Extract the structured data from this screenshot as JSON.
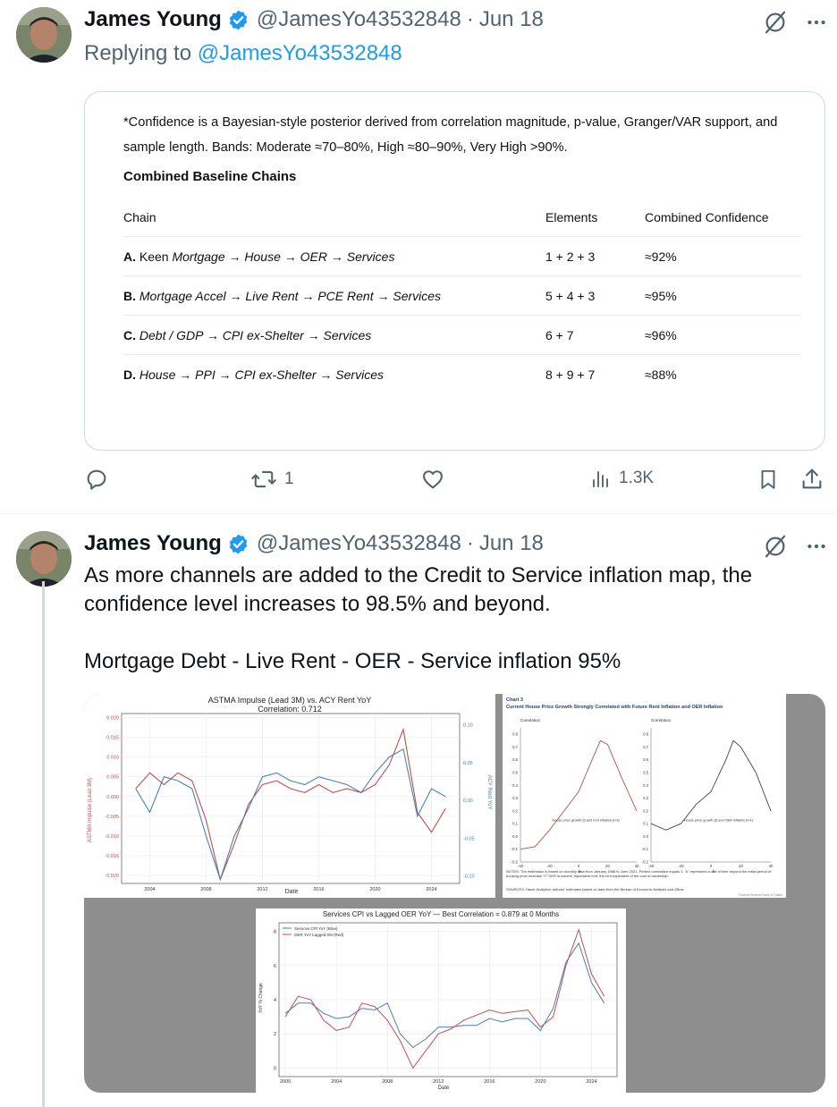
{
  "tweet1": {
    "name": "James Young",
    "handle": "@JamesYo43532848",
    "separator": "·",
    "date": "Jun 18",
    "reply_prefix": "Replying to",
    "reply_handle": "@JamesYo43532848",
    "card": {
      "note": "*Confidence is a Bayesian-style posterior derived from correlation magnitude, p-value, Granger/VAR support, and sample length. Bands: Moderate ≈70–80%, High ≈80–90%, Very High >90%.",
      "title": "Combined Baseline Chains",
      "headers": [
        "Chain",
        "Elements",
        "Combined Confidence"
      ],
      "rows": [
        {
          "letter": "A.",
          "prefix": "Keen",
          "chain": "Mortgage → House → OER → Services",
          "elements": "1 + 2 + 3",
          "confidence": "≈92%"
        },
        {
          "letter": "B.",
          "prefix": "",
          "chain": "Mortgage Accel → Live Rent → PCE Rent → Services",
          "elements": "5 + 4 + 3",
          "confidence": "≈95%"
        },
        {
          "letter": "C.",
          "prefix": "",
          "chain": "Debt / GDP → CPI ex-Shelter → Services",
          "elements": "6 + 7",
          "confidence": "≈96%"
        },
        {
          "letter": "D.",
          "prefix": "",
          "chain": "House → PPI → CPI ex-Shelter → Services",
          "elements": "8 + 9 + 7",
          "confidence": "≈88%"
        }
      ]
    },
    "actions": {
      "replies": "",
      "reposts": "1",
      "likes": "",
      "views": "1.3K"
    }
  },
  "tweet2": {
    "name": "James Young",
    "handle": "@JamesYo43532848",
    "separator": "·",
    "date": "Jun 18",
    "text_para1": "As more channels are added to the Credit to Service inflation map, the confidence level increases to 98.5% and beyond.",
    "text_para2": "Mortgage Debt - Live Rent - OER - Service inflation 95%"
  },
  "colors": {
    "link": "#1d9bf0",
    "verified": "#1d9bf0",
    "muted": "#536471",
    "red_series": "#c0504d",
    "blue_series": "#4a7fb5"
  },
  "chart_data": [
    {
      "type": "line",
      "title": "ASTMA Impulse (Lead 3M) vs. ACY Rent YoY",
      "subtitle": "Correlation: 0.712",
      "xlabel": "Date",
      "ylabel_left": "ASTMA Impulse (Lead 3M)",
      "ylabel_right": "ACY Rent YoY",
      "x_ticks": [
        "2004",
        "2008",
        "2012",
        "2016",
        "2020",
        "2024"
      ],
      "y_left_ticks": [
        "0.020",
        "0.015",
        "0.010",
        "0.005",
        "0.000",
        "-0.005",
        "-0.010",
        "-0.015",
        "-0.020"
      ],
      "y_right_ticks": [
        "0.10",
        "0.05",
        "0.00",
        "-0.05",
        "-0.10"
      ],
      "ylim_left": [
        -0.022,
        0.021
      ],
      "series": [
        {
          "color": "red",
          "x": [
            2003,
            2004,
            2005,
            2006,
            2007,
            2008,
            2009,
            2010,
            2011,
            2012,
            2013,
            2014,
            2015,
            2016,
            2017,
            2018,
            2019,
            2020,
            2021,
            2022,
            2023,
            2024,
            2025
          ],
          "values": [
            0.002,
            0.006,
            0.003,
            0.006,
            0.004,
            -0.006,
            -0.021,
            -0.012,
            -0.002,
            0.003,
            0.004,
            0.002,
            0.001,
            0.003,
            0.001,
            0.002,
            0.001,
            0.003,
            0.008,
            0.017,
            -0.004,
            -0.009,
            -0.003
          ]
        },
        {
          "color": "blue",
          "x": [
            2003,
            2004,
            2005,
            2006,
            2007,
            2008,
            2009,
            2010,
            2011,
            2012,
            2013,
            2014,
            2015,
            2016,
            2017,
            2018,
            2019,
            2020,
            2021,
            2022,
            2023,
            2024,
            2025
          ],
          "values": [
            0.002,
            -0.004,
            0.005,
            0.004,
            0.002,
            -0.01,
            -0.021,
            -0.01,
            -0.003,
            0.005,
            0.006,
            0.004,
            0.003,
            0.005,
            0.004,
            0.003,
            0.001,
            0.006,
            0.01,
            0.012,
            -0.005,
            0.002,
            0.0
          ]
        }
      ]
    },
    {
      "type": "line",
      "chart_label": "Chart 3",
      "title": "Current House Price Growth Strongly Correlated with Future Rent Inflation and OER Inflation",
      "panels": [
        {
          "ylabel": "Correlation",
          "legend": "House price growth (t) and rent inflation (t+k)",
          "x": [
            -40,
            -30,
            -20,
            -10,
            0,
            10,
            15,
            20,
            30,
            40
          ],
          "values": [
            -0.1,
            -0.08,
            0.05,
            0.2,
            0.35,
            0.62,
            0.75,
            0.72,
            0.45,
            0.2
          ]
        },
        {
          "ylabel": "Correlation",
          "legend": "House price growth (t) and OER inflation (t+k)",
          "x": [
            -40,
            -30,
            -20,
            -10,
            0,
            10,
            15,
            20,
            30,
            40
          ],
          "values": [
            0.1,
            0.05,
            0.1,
            0.25,
            0.35,
            0.6,
            0.75,
            0.7,
            0.5,
            0.2
          ]
        }
      ],
      "x_ticks": [
        "-40",
        "-20",
        "0",
        "20",
        "40"
      ],
      "y_ticks": [
        "0.8",
        "0.7",
        "0.6",
        "0.5",
        "0.4",
        "0.3",
        "0.2",
        "0.1",
        "0.0",
        "-0.1",
        "-0.2"
      ],
      "xlabel": "k",
      "notes": "NOTES: The estimation is based on monthly data from January 1986 to June 2021. Perfect correlation equals 1. \"k\" represents a unit of time beyond the initial period of housing price increase \"t.\" OER is owners' equivalent rent, the rent equivalent of the cost of ownership.",
      "sources": "SOURCES: Haver Analytics; authors' estimates based on data from the Bureau of Economic Analysis and Zillow.",
      "credit": "Federal Reserve Bank of Dallas"
    },
    {
      "type": "line",
      "title": "Services CPI vs Lagged OER YoY — Best Correlation = 0.879 at 0 Months",
      "xlabel": "Date",
      "ylabel": "YoY % Change",
      "x_ticks": [
        "2000",
        "2004",
        "2008",
        "2012",
        "2016",
        "2020",
        "2024"
      ],
      "y_ticks": [
        "8",
        "6",
        "4",
        "2",
        "0"
      ],
      "ylim": [
        -0.5,
        8.5
      ],
      "series": [
        {
          "name": "Services CPI YoY (Blue)",
          "color": "blue",
          "x": [
            2000,
            2001,
            2002,
            2003,
            2004,
            2005,
            2006,
            2007,
            2008,
            2009,
            2010,
            2011,
            2012,
            2013,
            2014,
            2015,
            2016,
            2017,
            2018,
            2019,
            2020,
            2021,
            2022,
            2023,
            2024,
            2025
          ],
          "values": [
            3.2,
            3.8,
            3.8,
            3.2,
            2.9,
            3.0,
            3.5,
            3.4,
            3.8,
            2.0,
            1.2,
            1.7,
            2.4,
            2.4,
            2.5,
            2.5,
            2.9,
            2.7,
            2.9,
            2.9,
            2.2,
            3.5,
            6.2,
            7.3,
            5.0,
            3.8
          ]
        },
        {
          "name": "OER YoY Lagged 0M (Red)",
          "color": "red",
          "x": [
            2000,
            2001,
            2002,
            2003,
            2004,
            2005,
            2006,
            2007,
            2008,
            2009,
            2010,
            2011,
            2012,
            2013,
            2014,
            2015,
            2016,
            2017,
            2018,
            2019,
            2020,
            2021,
            2022,
            2023,
            2024,
            2025
          ],
          "values": [
            3.0,
            4.2,
            4.0,
            2.8,
            2.2,
            2.4,
            3.8,
            3.6,
            2.8,
            1.6,
            0.0,
            1.0,
            2.0,
            2.3,
            2.8,
            3.1,
            3.4,
            3.2,
            3.3,
            3.4,
            2.4,
            3.0,
            6.0,
            8.1,
            5.5,
            4.2
          ]
        }
      ]
    }
  ]
}
